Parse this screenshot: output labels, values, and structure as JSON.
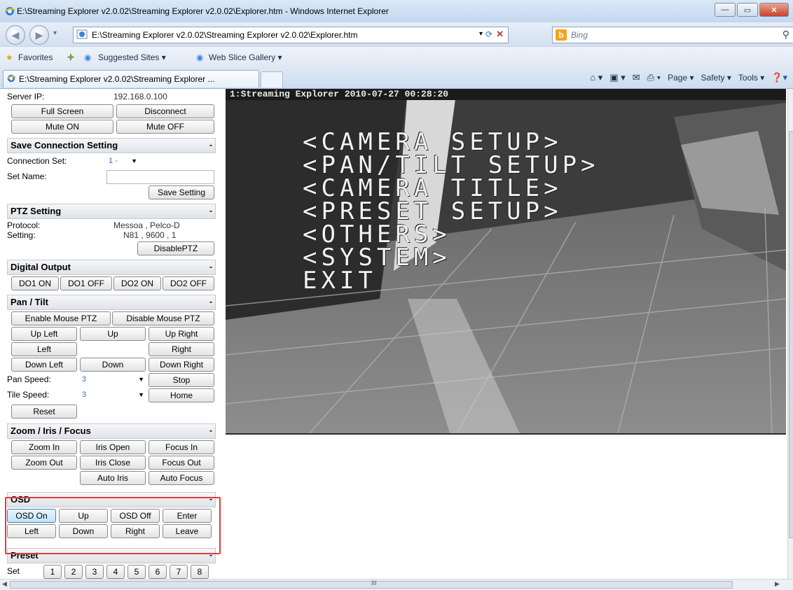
{
  "window": {
    "title": "E:\\Streaming Explorer v2.0.02\\Streaming Explorer v2.0.02\\Explorer.htm - Windows Internet Explorer",
    "minimize": "—",
    "maximize": "▭",
    "close": "✕"
  },
  "address_bar": {
    "url": "E:\\Streaming Explorer v2.0.02\\Streaming Explorer v2.0.02\\Explorer.htm",
    "search_placeholder": "Bing"
  },
  "favorites_bar": {
    "favorites": "Favorites",
    "suggested_sites": "Suggested Sites ▾",
    "web_slice_gallery": "Web Slice Gallery ▾"
  },
  "tab": {
    "title": "E:\\Streaming Explorer v2.0.02\\Streaming Explorer ..."
  },
  "command_bar": {
    "page": "Page ▾",
    "safety": "Safety ▾",
    "tools": "Tools ▾"
  },
  "panel": {
    "server": {
      "label": "Server IP:",
      "value": "192.168.0.100",
      "full_screen": "Full Screen",
      "disconnect": "Disconnect",
      "mute_on": "Mute ON",
      "mute_off": "Mute OFF"
    },
    "save_connection": {
      "title": "Save Connection Setting",
      "collapse": "-",
      "connection_set_label": "Connection Set:",
      "connection_set_value": "1 -",
      "set_name_label": "Set Name:",
      "set_name_value": "",
      "save_button": "Save Setting"
    },
    "ptz_setting": {
      "title": "PTZ Setting",
      "collapse": "-",
      "protocol_label": "Protocol:",
      "protocol_value": "Messoa , Pelco-D",
      "setting_label": "Setting:",
      "setting_value": "N81 , 9600 , 1",
      "disable_button": "DisablePTZ"
    },
    "digital_output": {
      "title": "Digital Output",
      "collapse": "-",
      "buttons": [
        "DO1 ON",
        "DO1 OFF",
        "DO2 ON",
        "DO2 OFF"
      ]
    },
    "pan_tilt": {
      "title": "Pan / Tilt",
      "collapse": "-",
      "enable_mouse": "Enable Mouse PTZ",
      "disable_mouse": "Disable Mouse PTZ",
      "up_left": "Up Left",
      "up": "Up",
      "up_right": "Up Right",
      "left": "Left",
      "right": "Right",
      "down_left": "Down Left",
      "down": "Down",
      "down_right": "Down Right",
      "pan_speed_label": "Pan Speed:",
      "pan_speed_value": "3",
      "stop": "Stop",
      "tilt_speed_label": "Tile Speed:",
      "tilt_speed_value": "3",
      "home": "Home",
      "reset": "Reset"
    },
    "zoom_iris_focus": {
      "title": "Zoom / Iris / Focus",
      "collapse": "-",
      "zoom_in": "Zoom In",
      "iris_open": "Iris Open",
      "focus_in": "Focus In",
      "zoom_out": "Zoom Out",
      "iris_close": "Iris Close",
      "focus_out": "Focus Out",
      "auto_iris": "Auto Iris",
      "auto_focus": "Auto Focus"
    },
    "osd": {
      "title": "OSD",
      "collapse": "-",
      "osd_on": "OSD On",
      "up": "Up",
      "osd_off": "OSD Off",
      "enter": "Enter",
      "left": "Left",
      "down": "Down",
      "right": "Right",
      "leave": "Leave"
    },
    "preset": {
      "title": "Preset",
      "collapse": "-",
      "set_label": "Set",
      "numbers": [
        "1",
        "2",
        "3",
        "4",
        "5",
        "6",
        "7",
        "8"
      ]
    }
  },
  "video": {
    "caption": "1:Streaming Explorer  2010-07-27 00:28:20",
    "osd_menu": [
      "<CAMERA SETUP>",
      "<PAN/TILT SETUP>",
      "<CAMERA TITLE>",
      "<PRESET SETUP>",
      "<OTHERS>",
      "<SYSTEM>",
      "EXIT"
    ]
  },
  "scrollbar": {
    "grip": "III"
  }
}
